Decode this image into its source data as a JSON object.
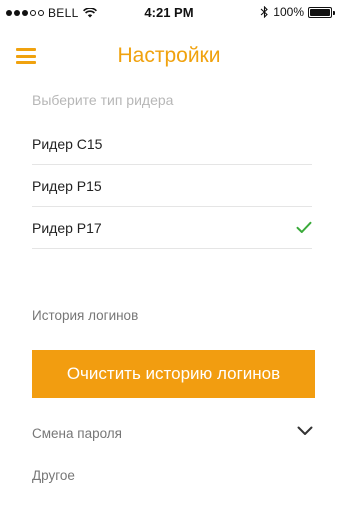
{
  "status_bar": {
    "carrier": "BELL",
    "time": "4:21 PM",
    "battery": "100%",
    "icons": [
      "signal-dots-icon",
      "wifi-icon",
      "bluetooth-icon",
      "battery-icon"
    ]
  },
  "nav": {
    "title": "Настройки",
    "menu_icon": "hamburger-menu-icon"
  },
  "reader_section": {
    "hint": "Выберите тип ридера",
    "items": [
      {
        "label": "Ридер C15",
        "selected": false
      },
      {
        "label": "Ридер P15",
        "selected": false
      },
      {
        "label": "Ридер P17",
        "selected": true
      }
    ],
    "check_icon": "checkmark-icon"
  },
  "history": {
    "label": "История логинов",
    "clear_button": "Очистить историю логинов"
  },
  "password": {
    "label": "Смена пароля",
    "icon": "chevron-down-icon"
  },
  "other": {
    "label": "Другое"
  },
  "colors": {
    "accent": "#f0a20e",
    "button": "#f29d10",
    "check": "#3aaa3a",
    "muted_text": "#b7b7b7"
  }
}
